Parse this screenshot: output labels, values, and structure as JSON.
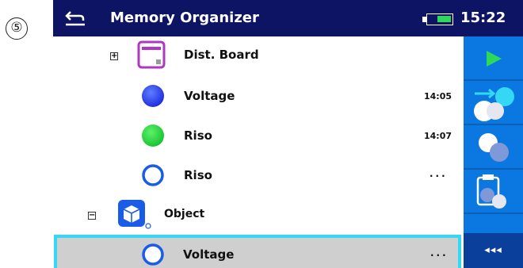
{
  "step_marker": "⑤",
  "header": {
    "title": "Memory Organizer",
    "time": "15:22",
    "back_icon": "back-arrow-icon",
    "battery_icon": "battery-icon",
    "colors": {
      "bar": "#0d1464",
      "battery_fill": "#2fd85a"
    }
  },
  "tree": [
    {
      "label": "Dist. Board",
      "icon": "distribution-board-icon",
      "expander": "+",
      "time": ""
    },
    {
      "label": "Voltage",
      "icon": "blue-filled-circle-icon",
      "time": "14:05"
    },
    {
      "label": "Riso",
      "icon": "green-filled-circle-icon",
      "time": "14:07"
    },
    {
      "label": "Riso",
      "icon": "blue-empty-circle-icon",
      "time": "..."
    },
    {
      "label": "Object",
      "icon": "object-cube-icon",
      "expander": "−",
      "time": ""
    },
    {
      "label": "Voltage",
      "icon": "blue-empty-circle-icon",
      "time": "...",
      "selected": true
    }
  ],
  "sidebar": {
    "buttons": [
      "start-test-icon",
      "clone-test-icon",
      "copy-test-icon",
      "paste-test-icon"
    ],
    "more_label": "◂◂◂",
    "colors": {
      "panel": "#0a78e0",
      "bottom": "#0b3f9c",
      "selection_outline": "#35d8f4"
    }
  }
}
